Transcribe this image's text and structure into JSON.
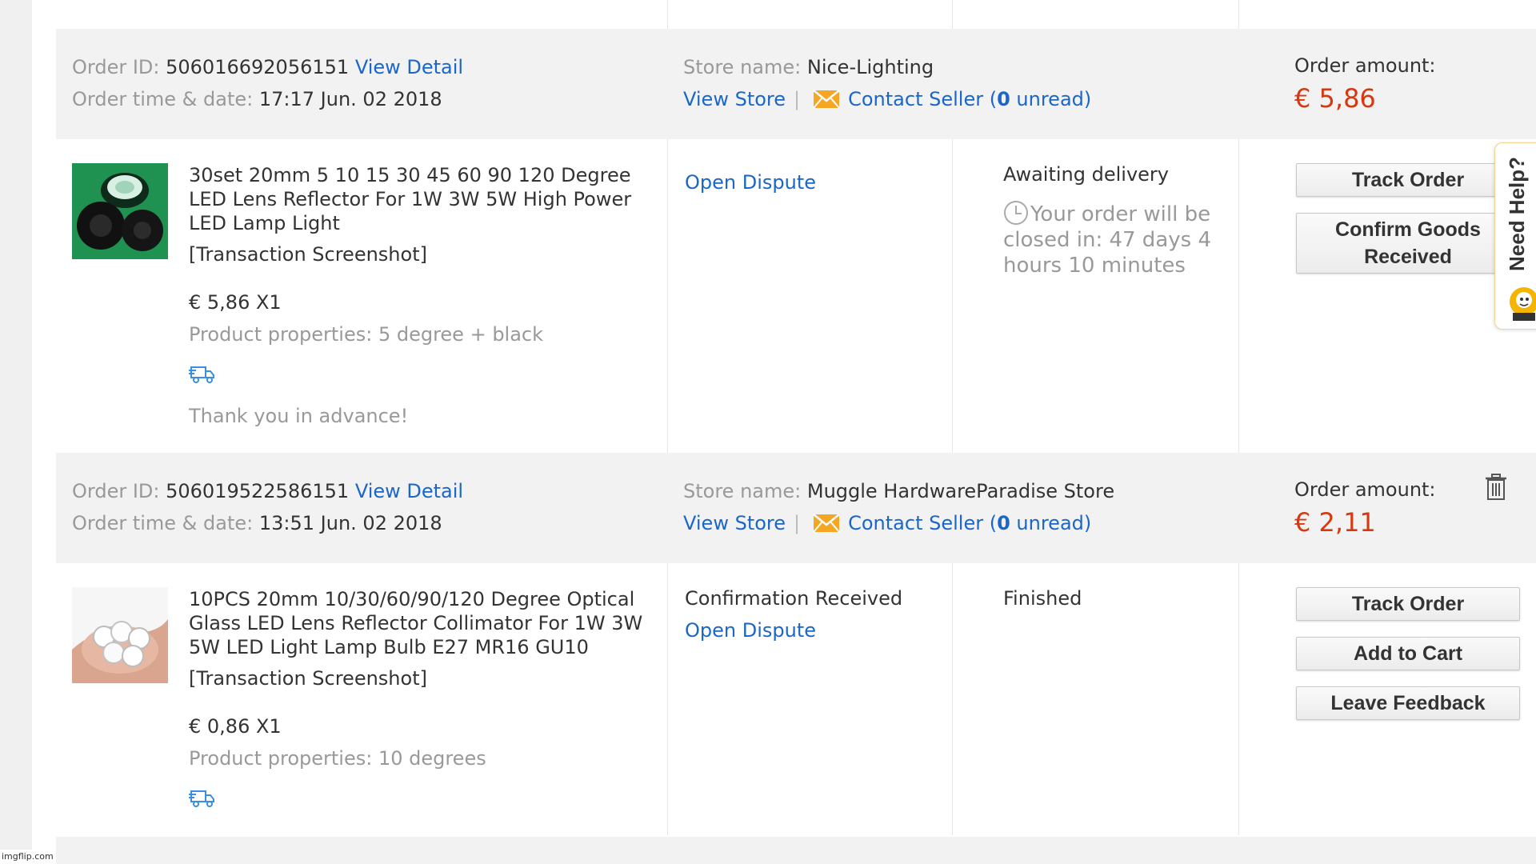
{
  "orders": [
    {
      "id_label": "Order ID:",
      "id_value": "506016692056151",
      "view_detail": "View Detail",
      "time_label": "Order time & date:",
      "time_value": "17:17 Jun. 02 2018",
      "store_label": "Store name:",
      "store_value": "Nice-Lighting",
      "view_store": "View Store",
      "separator": "|",
      "contact_prefix": "Contact Seller (",
      "contact_count": "0",
      "contact_suffix": " unread)",
      "amount_label": "Order amount:",
      "amount_value": "€ 5,86",
      "product": {
        "title": "30set 20mm 5 10 15 30 45 60 90 120 Degree LED Lens Reflector For 1W 3W 5W High Power LED Lamp Light",
        "screenshot": "[Transaction Screenshot]",
        "price_qty": "€ 5,86 X1",
        "properties": "Product properties: 5 degree + black",
        "note": "Thank you in advance!"
      },
      "dispute": "Open Dispute",
      "status": "Awaiting delivery",
      "countdown": "Your order will be closed in: 47 days 4 hours 10 minutes",
      "buttons": {
        "track": "Track Order",
        "confirm_line1": "Confirm Goods",
        "confirm_line2": "Received"
      }
    },
    {
      "id_label": "Order ID:",
      "id_value": "506019522586151",
      "view_detail": "View Detail",
      "time_label": "Order time & date:",
      "time_value": "13:51 Jun. 02 2018",
      "store_label": "Store name:",
      "store_value": "Muggle HardwareParadise Store",
      "view_store": "View Store",
      "separator": "|",
      "contact_prefix": "Contact Seller (",
      "contact_count": "0",
      "contact_suffix": " unread)",
      "amount_label": "Order amount:",
      "amount_value": "€ 2,11",
      "product": {
        "title": "10PCS 20mm 10/30/60/90/120 Degree Optical Glass LED Lens Reflector Collimator For 1W 3W 5W LED Light Lamp Bulb E27 MR16 GU10",
        "screenshot": "[Transaction Screenshot]",
        "price_qty": "€ 0,86 X1",
        "properties": "Product properties: 10 degrees"
      },
      "confirmation": "Confirmation Received",
      "dispute": "Open Dispute",
      "status": "Finished",
      "buttons": {
        "track": "Track Order",
        "cart": "Add to Cart",
        "feedback": "Leave Feedback"
      }
    }
  ],
  "help_tab": {
    "label": "Need Help?"
  },
  "watermark": "imgflip.com",
  "icons": {
    "mail": "envelope-icon",
    "truck": "truck-icon",
    "clock": "clock-icon",
    "trash": "trash-icon"
  },
  "colors": {
    "link": "#1a66c9",
    "price": "#d6380f",
    "muted": "#999999",
    "mail_icon": "#f5a623"
  }
}
